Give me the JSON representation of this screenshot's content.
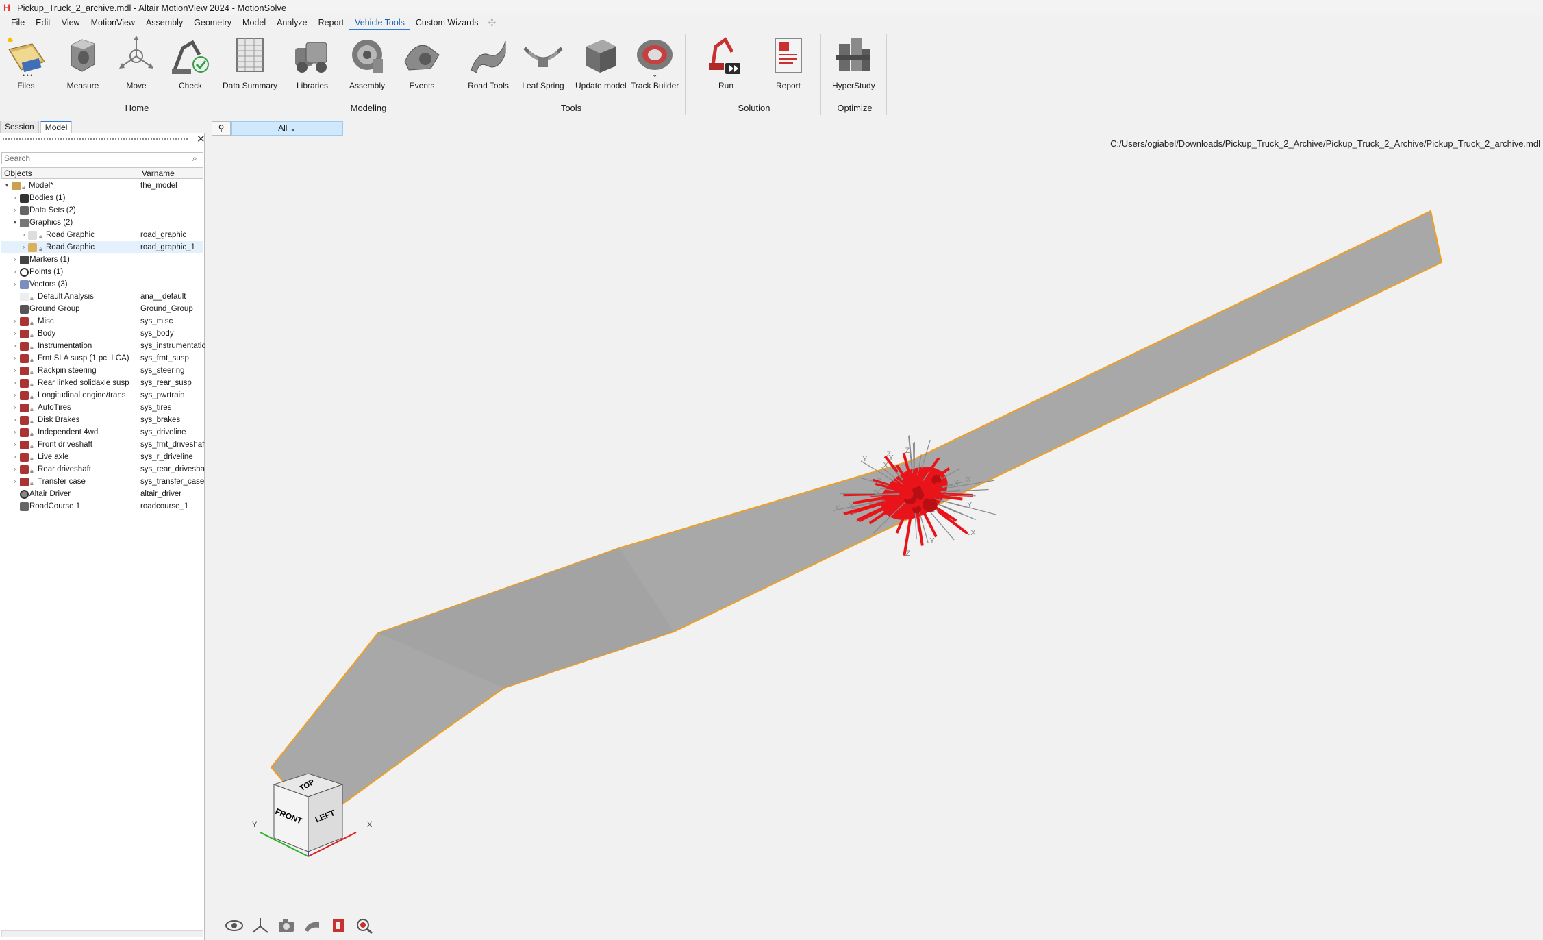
{
  "window": {
    "title": "Pickup_Truck_2_archive.mdl - Altair MotionView 2024 - MotionSolve",
    "logo": "H"
  },
  "menu": {
    "items": [
      "File",
      "Edit",
      "View",
      "MotionView",
      "Assembly",
      "Geometry",
      "Model",
      "Analyze",
      "Report",
      "Vehicle Tools",
      "Custom Wizards"
    ],
    "active": "Vehicle Tools",
    "add_icon": "plus-icon"
  },
  "ribbon": {
    "groups": [
      {
        "label": "Home",
        "tools": [
          "Files",
          "Measure",
          "Move",
          "Check",
          "Data Summary"
        ]
      },
      {
        "label": "Modeling",
        "tools": [
          "Libraries",
          "Assembly",
          "Events"
        ]
      },
      {
        "label": "Tools",
        "tools": [
          "Road Tools",
          "Leaf Spring",
          "Update model",
          "Track Builder"
        ]
      },
      {
        "label": "Solution",
        "tools": [
          "Run",
          "Report"
        ]
      },
      {
        "label": "Optimize",
        "tools": [
          "HyperStudy"
        ]
      }
    ]
  },
  "panel": {
    "tabs": [
      "Session",
      "Model"
    ],
    "active_tab": "Model",
    "search_placeholder": "Search",
    "columns": [
      "Objects",
      "Varname"
    ],
    "rows": [
      {
        "label": "Model*",
        "var": "the_model"
      },
      {
        "label": "Bodies  (1)",
        "var": ""
      },
      {
        "label": "Data Sets  (2)",
        "var": ""
      },
      {
        "label": "Graphics  (2)",
        "var": ""
      },
      {
        "label": "Road Graphic",
        "var": "road_graphic"
      },
      {
        "label": "Road Graphic",
        "var": "road_graphic_1"
      },
      {
        "label": "Markers  (1)",
        "var": ""
      },
      {
        "label": "Points  (1)",
        "var": ""
      },
      {
        "label": "Vectors  (3)",
        "var": ""
      },
      {
        "label": "Default Analysis",
        "var": "ana__default"
      },
      {
        "label": "Ground Group",
        "var": "Ground_Group"
      },
      {
        "label": "Misc",
        "var": "sys_misc"
      },
      {
        "label": "Body",
        "var": "sys_body"
      },
      {
        "label": "Instrumentation",
        "var": "sys_instrumentation"
      },
      {
        "label": "Frnt SLA susp (1 pc. LCA)",
        "var": "sys_frnt_susp"
      },
      {
        "label": "Rackpin steering",
        "var": "sys_steering"
      },
      {
        "label": "Rear linked solidaxle susp",
        "var": "sys_rear_susp"
      },
      {
        "label": "Longitudinal engine/trans",
        "var": "sys_pwrtrain"
      },
      {
        "label": "AutoTires",
        "var": "sys_tires"
      },
      {
        "label": "Disk Brakes",
        "var": "sys_brakes"
      },
      {
        "label": "Independent 4wd",
        "var": "sys_driveline"
      },
      {
        "label": "Front driveshaft",
        "var": "sys_frnt_driveshaft"
      },
      {
        "label": "Live axle",
        "var": "sys_r_driveline"
      },
      {
        "label": "Rear driveshaft",
        "var": "sys_rear_driveshaft"
      },
      {
        "label": "Transfer case",
        "var": "sys_transfer_case"
      },
      {
        "label": "Altair Driver",
        "var": "altair_driver"
      },
      {
        "label": "RoadCourse 1",
        "var": "roadcourse_1"
      }
    ]
  },
  "filter": {
    "value": "All"
  },
  "viewport": {
    "file_path": "C:/Users/ogiabel/Downloads/Pickup_Truck_2_Archive/Pickup_Truck_2_Archive/Pickup_Truck_2_archive.mdl",
    "view_cube": {
      "top": "TOP",
      "front": "FRONT",
      "left": "LEFT",
      "axis_x": "X",
      "axis_y": "Y"
    },
    "marker_labels": {
      "z": "Z",
      "y": "Y",
      "x": "X"
    },
    "colors": {
      "road_fill": "#a9a9a9",
      "road_edge": "#f0a020",
      "vehicle": "#e8141a",
      "accent": "#2a7ad8"
    }
  },
  "bottom_toolbar": [
    "eye-icon",
    "axes-icon",
    "camera-icon",
    "clipping-icon",
    "section-icon",
    "zoom-icon"
  ]
}
